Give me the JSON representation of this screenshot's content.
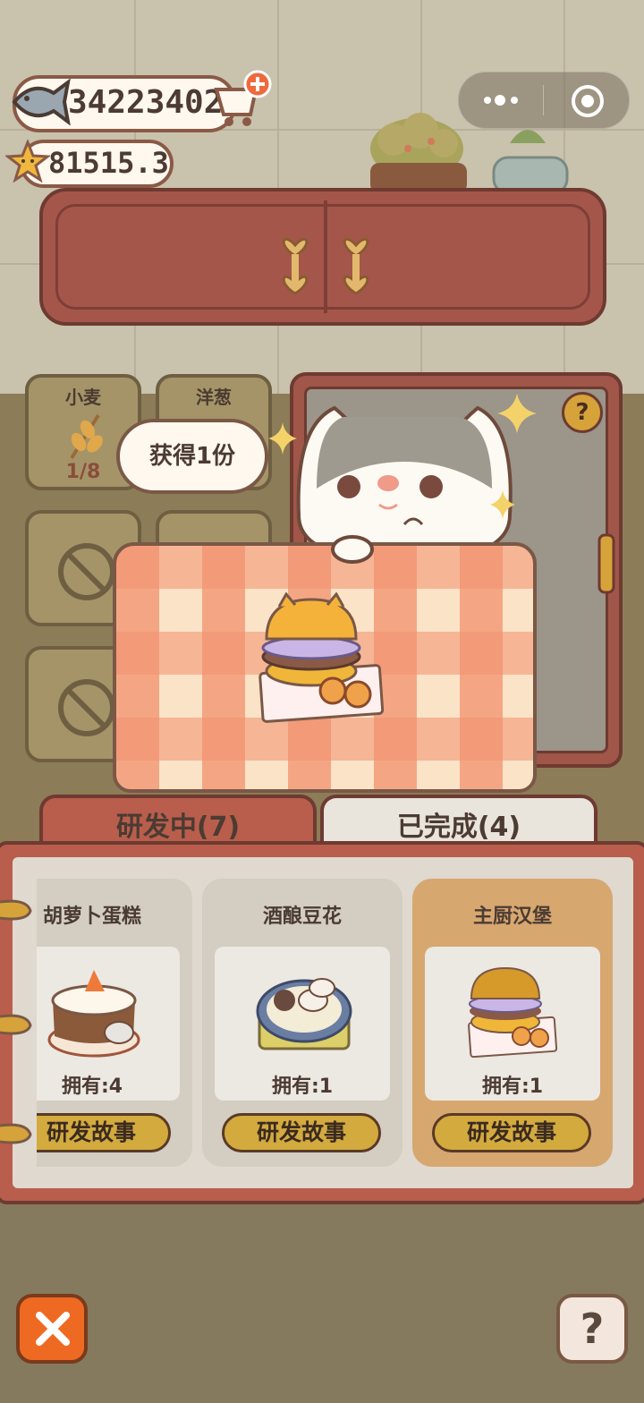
{
  "currency": {
    "fish_amount": "34223402",
    "star_amount": "81515.3"
  },
  "ingredients": [
    {
      "label": "小麦",
      "count": "1/8"
    },
    {
      "label": "洋葱",
      "count": ""
    }
  ],
  "bubble_text": "获得1份",
  "machine_help": "?",
  "tabs": [
    {
      "label": "研发中(7)"
    },
    {
      "label": "已完成(4)"
    }
  ],
  "recipes": [
    {
      "title": "胡萝卜蛋糕",
      "owned": "拥有:4",
      "button": "研发故事"
    },
    {
      "title": "酒酿豆花",
      "owned": "拥有:1",
      "button": "研发故事"
    },
    {
      "title": "主厨汉堡",
      "owned": "拥有:1",
      "button": "研发故事"
    }
  ],
  "help_button": "?",
  "colors": {
    "accent": "#d3aa3e",
    "panel": "#b95e4c",
    "close": "#ee6a23",
    "selected_card": "#d7a770"
  }
}
